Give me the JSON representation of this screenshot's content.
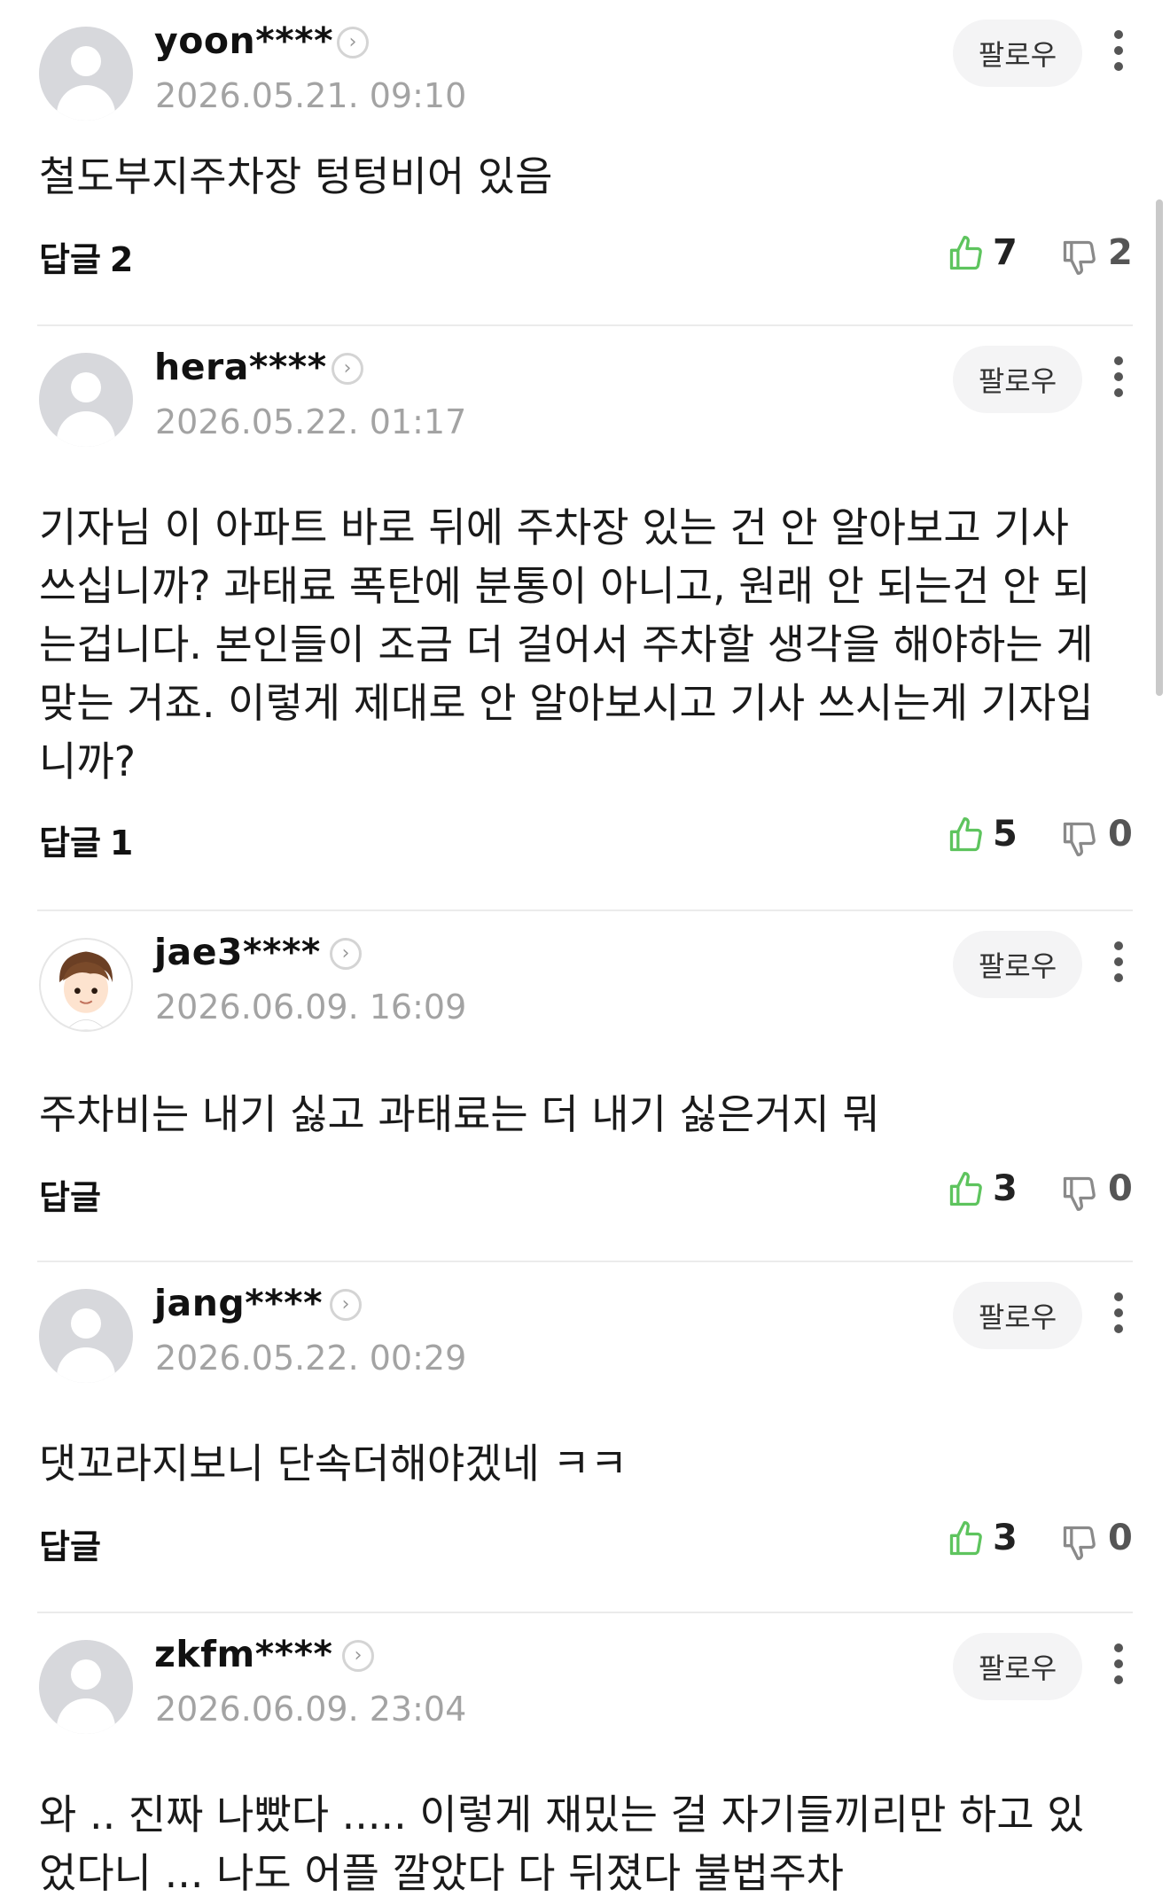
{
  "follow_label": "팔로우",
  "reply_label": "답글",
  "colors": {
    "like": "#5ec45e",
    "dislike": "#8a8a8a",
    "timestamp": "#a3a3a3",
    "divider": "#ebebeb",
    "follow_bg": "#f4f4f5"
  },
  "icons": [
    "profile-chevron-icon",
    "more-vertical-icon",
    "thumbs-up-icon",
    "thumbs-down-icon",
    "default-avatar-icon"
  ],
  "comments": [
    {
      "username": "yoon****",
      "timestamp": "2026.05.21. 09:10",
      "text": "철도부지주차장 텅텅비어 있음",
      "reply_count": "2",
      "likes": "7",
      "dislikes": "2"
    },
    {
      "username": "hera****",
      "timestamp": "2026.05.22. 01:17",
      "text": "기자님 이 아파트 바로 뒤에 주차장 있는 건 안 알아보고 기사 쓰십니까? 과태료 폭탄에 분통이 아니고, 원래 안 되는건 안 되는겁니다. 본인들이 조금 더 걸어서 주차할 생각을 해야하는 게 맞는 거죠. 이렇게 제대로 안 알아보시고 기사 쓰시는게 기자입니까?",
      "reply_count": "1",
      "likes": "5",
      "dislikes": "0"
    },
    {
      "username": "jae3****",
      "timestamp": "2026.06.09. 16:09",
      "text": "주차비는 내기 싫고 과태료는 더 내기 싫은거지 뭐",
      "reply_count": "",
      "likes": "3",
      "dislikes": "0"
    },
    {
      "username": "jang****",
      "timestamp": "2026.05.22. 00:29",
      "text": "댓꼬라지보니 단속더해야겠네 ㅋㅋ",
      "reply_count": "",
      "likes": "3",
      "dislikes": "0"
    },
    {
      "username": "zkfm****",
      "timestamp": "2026.06.09. 23:04",
      "text": "와 .. 진짜 나빴다 ..... 이렇게 재밌는 걸 자기들끼리만 하고 있었다니 ... 나도 어플 깔았다 다 뒤졌다 불법주차",
      "reply_count": "",
      "likes": "",
      "dislikes": ""
    }
  ]
}
